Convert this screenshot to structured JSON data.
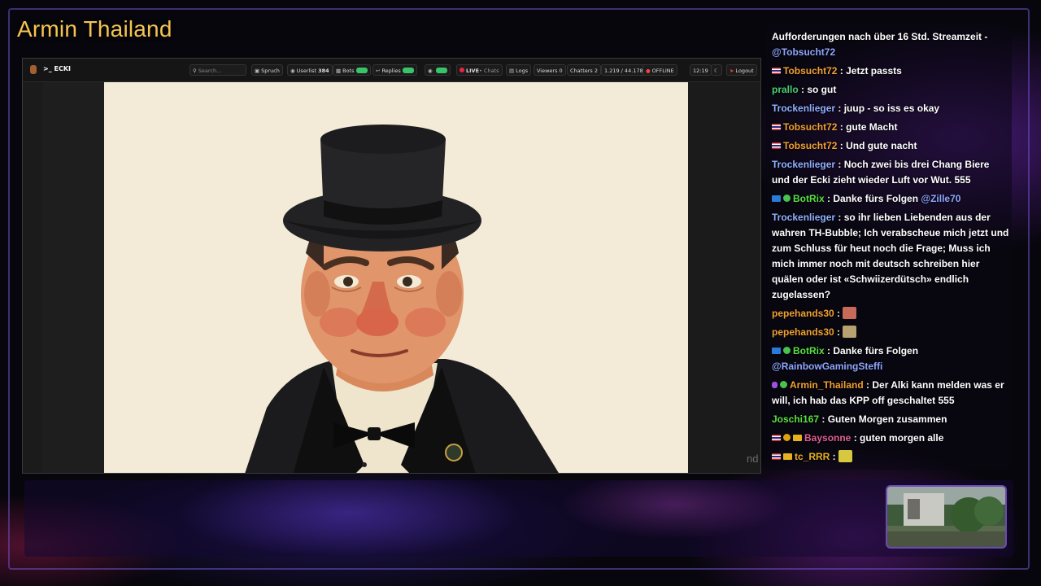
{
  "overlay": {
    "stream_title": "Armin Thailand"
  },
  "app": {
    "prompt_label": ">_ ECKI",
    "toolbar": {
      "search_placeholder": "Search...",
      "spruch": "Spruch",
      "userlist": "Userlist",
      "userlist_count": "384",
      "bots": "Bots",
      "replies": "Replies",
      "live": "LIVE",
      "chats": "• Chats",
      "logs": "Logs",
      "viewers": "Viewers 0",
      "chatters": "Chatters 2",
      "ratio": "1.219 / 44.178",
      "offline": "OFFLINE",
      "time": "12:19",
      "logout": "Logout"
    },
    "side_text": "nd"
  },
  "chat": {
    "messages": [
      {
        "badges": [],
        "user": "",
        "user_color": "#ffffff",
        "text": "Aufforderungen nach über 16 Std. Streamzeit -",
        "mention": "@Tobsucht72"
      },
      {
        "badges": [
          "flag"
        ],
        "user": "Tobsucht72",
        "user_color": "#f0a030",
        "text": "Jetzt passts"
      },
      {
        "badges": [],
        "user": "prallo",
        "user_color": "#48d070",
        "text": "so gut"
      },
      {
        "badges": [],
        "user": "Trockenlieger",
        "user_color": "#8fb0ff",
        "text": "juup - so iss es okay"
      },
      {
        "badges": [
          "flag"
        ],
        "user": "Tobsucht72",
        "user_color": "#f0a030",
        "text": "gute Macht"
      },
      {
        "badges": [
          "flag"
        ],
        "user": "Tobsucht72",
        "user_color": "#f0a030",
        "text": "Und gute nacht"
      },
      {
        "badges": [],
        "user": "Trockenlieger",
        "user_color": "#8fb0ff",
        "text": "Noch zwei bis drei Chang Biere und der Ecki zieht wieder Luft vor Wut. 555"
      },
      {
        "badges": [
          "bot",
          "check"
        ],
        "user": "BotRix",
        "user_color": "#58e040",
        "text": "Danke fürs Folgen",
        "mention": "@Zille70"
      },
      {
        "badges": [],
        "user": "Trockenlieger",
        "user_color": "#8fb0ff",
        "text": "so ihr lieben Liebenden aus der wahren TH-Bubble; Ich verabscheue mich jetzt und zum Schluss für heut noch die Frage; Muss ich mich immer noch mit deutsch schreiben hier quälen oder ist «Schwiizerdütsch» endlich zugelassen?"
      },
      {
        "badges": [],
        "user": "pepehands30",
        "user_color": "#f0a030",
        "text": "",
        "emote": "emote-1"
      },
      {
        "badges": [],
        "user": "pepehands30",
        "user_color": "#f0a030",
        "text": "",
        "emote": "emote-2"
      },
      {
        "badges": [
          "bot",
          "check"
        ],
        "user": "BotRix",
        "user_color": "#58e040",
        "text": "Danke fürs Folgen",
        "mention": "@RainbowGamingSteffi"
      },
      {
        "badges": [
          "mic",
          "check"
        ],
        "user": "Armin_Thailand",
        "user_color": "#f0a030",
        "text": "Der Alki kann melden was er will, ich hab das KPP off geschaltet 555"
      },
      {
        "badges": [],
        "user": "Joschi167",
        "user_color": "#58e040",
        "text": "Guten Morgen zusammen"
      },
      {
        "badges": [
          "flag",
          "bit",
          "crown"
        ],
        "user": "Baysonne",
        "user_color": "#e06090",
        "text": "guten morgen alle"
      },
      {
        "badges": [
          "flag",
          "crown"
        ],
        "user": "tc_RRR",
        "user_color": "#e6b020",
        "text": "",
        "emote": "emote-3"
      }
    ]
  },
  "colors": {
    "title": "#f5c452",
    "accent_purple": "#6b4ab2"
  }
}
